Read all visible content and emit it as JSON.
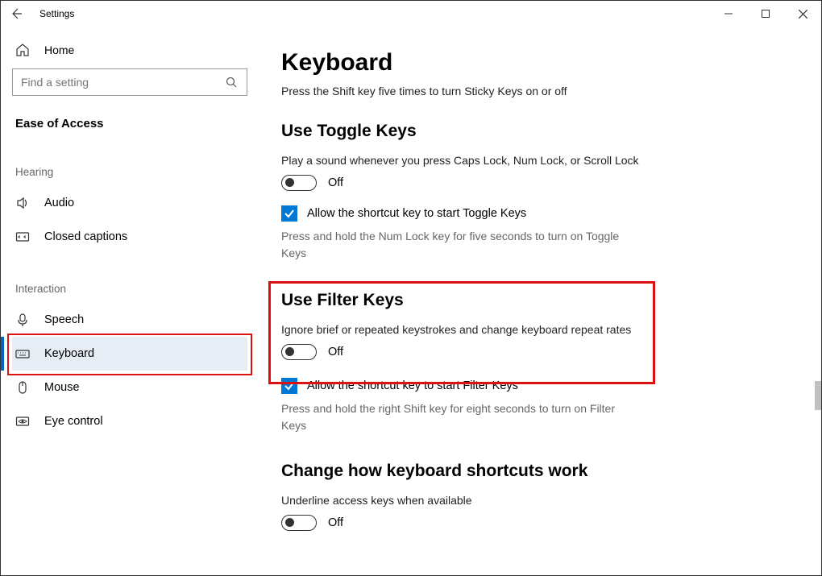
{
  "window": {
    "title": "Settings"
  },
  "sidebar": {
    "home": "Home",
    "search_placeholder": "Find a setting",
    "category": "Ease of Access",
    "hearing_label": "Hearing",
    "interaction_label": "Interaction",
    "items": {
      "audio": "Audio",
      "closed_captions": "Closed captions",
      "speech": "Speech",
      "keyboard": "Keyboard",
      "mouse": "Mouse",
      "eye_control": "Eye control"
    }
  },
  "main": {
    "title": "Keyboard",
    "sticky_hint": "Press the Shift key five times to turn Sticky Keys on or off",
    "toggle_keys": {
      "heading": "Use Toggle Keys",
      "desc": "Play a sound whenever you press Caps Lock, Num Lock, or Scroll Lock",
      "state": "Off",
      "check_label": "Allow the shortcut key to start Toggle Keys",
      "hint": "Press and hold the Num Lock key for five seconds to turn on Toggle Keys"
    },
    "filter_keys": {
      "heading": "Use Filter Keys",
      "desc": "Ignore brief or repeated keystrokes and change keyboard repeat rates",
      "state": "Off",
      "check_label": "Allow the shortcut key to start Filter Keys",
      "hint": "Press and hold the right Shift key for eight seconds to turn on Filter Keys"
    },
    "shortcuts": {
      "heading": "Change how keyboard shortcuts work",
      "desc": "Underline access keys when available",
      "state": "Off"
    }
  }
}
